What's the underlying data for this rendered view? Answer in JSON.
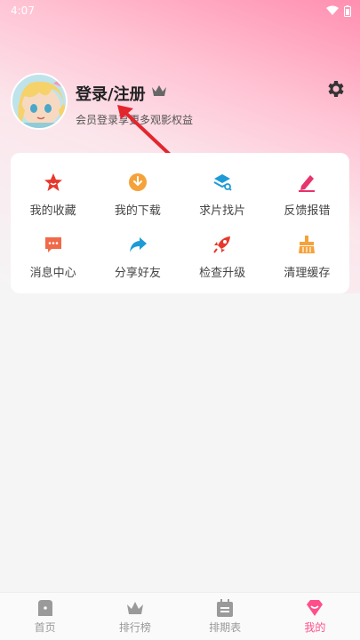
{
  "status_bar": {
    "time": "4:07"
  },
  "profile": {
    "title": "登录/注册",
    "member_text": "会员登录享更多观影权益"
  },
  "grid": [
    {
      "label": "我的收藏",
      "icon": "star-icon",
      "color": "#e6392c"
    },
    {
      "label": "我的下载",
      "icon": "download-cloud-icon",
      "color": "#f5a23a"
    },
    {
      "label": "求片找片",
      "icon": "film-search-icon",
      "color": "#1e9bd7"
    },
    {
      "label": "反馈报错",
      "icon": "pencil-icon",
      "color": "#e8336d"
    },
    {
      "label": "消息中心",
      "icon": "message-icon",
      "color": "#f06a4a"
    },
    {
      "label": "分享好友",
      "icon": "share-icon",
      "color": "#1e9bd7"
    },
    {
      "label": "检查升级",
      "icon": "rocket-icon",
      "color": "#e6392c"
    },
    {
      "label": "清理缓存",
      "icon": "broom-icon",
      "color": "#f5a23a"
    }
  ],
  "bottom_nav": [
    {
      "label": "首页",
      "icon": "home-icon"
    },
    {
      "label": "排行榜",
      "icon": "crown-icon"
    },
    {
      "label": "排期表",
      "icon": "calendar-icon"
    },
    {
      "label": "我的",
      "icon": "heart-diamond-icon",
      "active": true
    }
  ],
  "colors": {
    "accent": "#ff4f8b"
  }
}
